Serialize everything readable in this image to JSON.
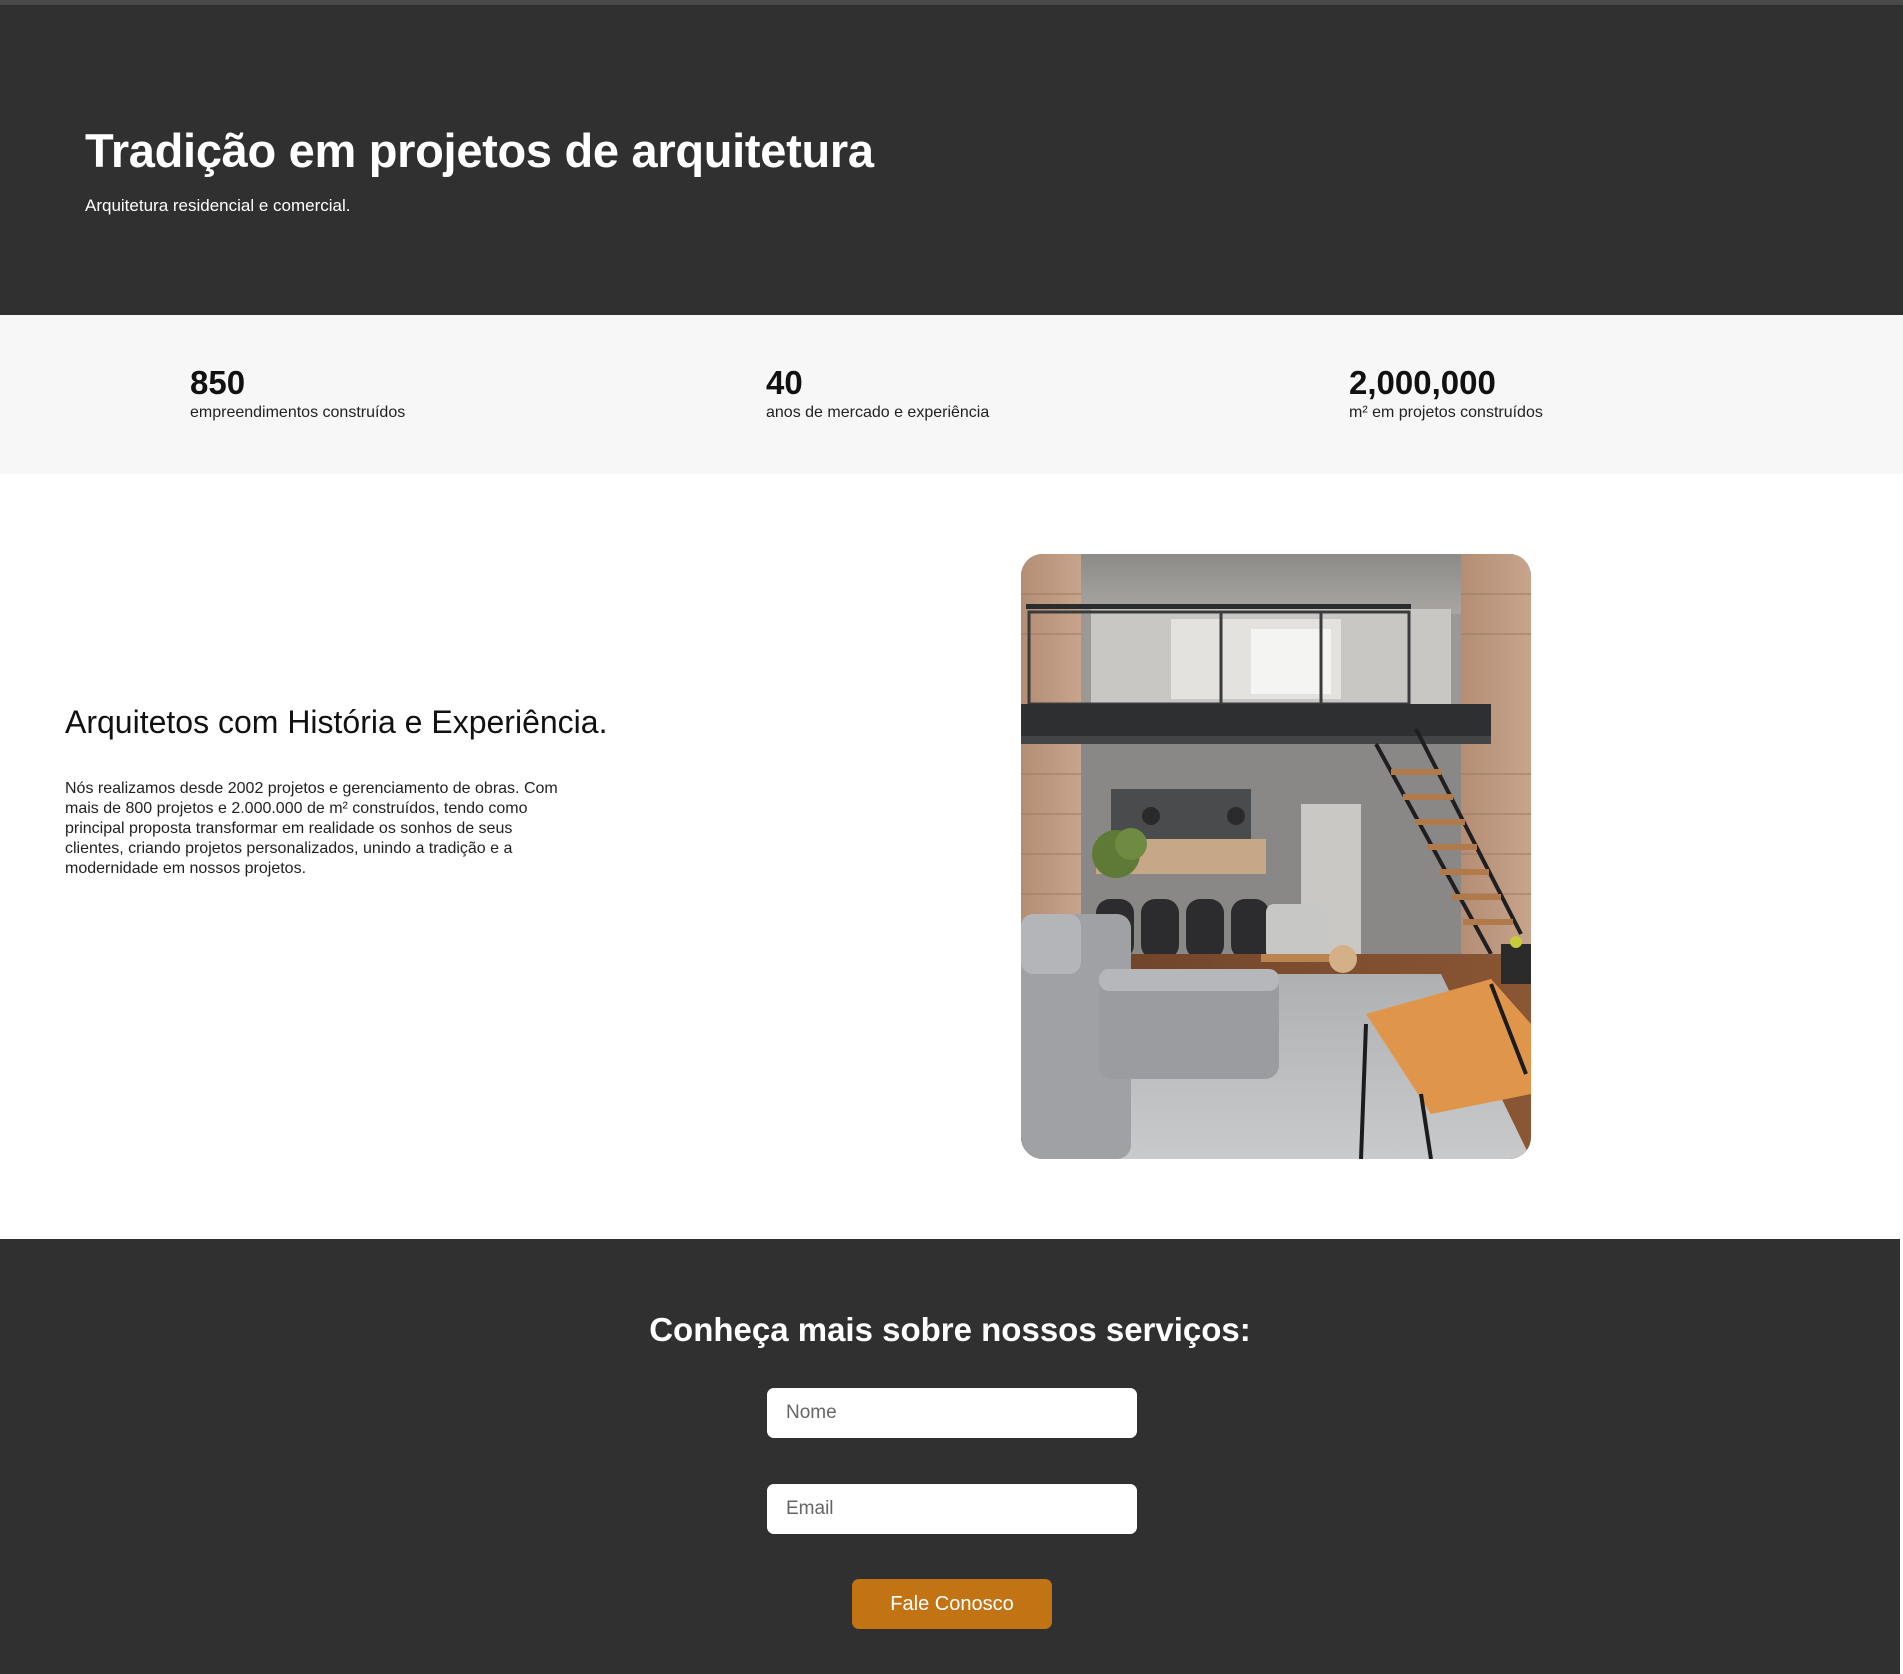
{
  "hero": {
    "title": "Tradição em projetos de arquitetura",
    "subtitle": "Arquitetura residencial e comercial."
  },
  "stats": [
    {
      "value": "850",
      "label": "empreendimentos construídos"
    },
    {
      "value": "40",
      "label": "anos de mercado e experiência"
    },
    {
      "value": "2,000,000",
      "label": "m² em projetos construídos"
    }
  ],
  "about": {
    "heading": "Arquitetos com História e Experiência.",
    "body": "Nós realizamos desde 2002 projetos e gerenciamento de obras. Com mais de 800 projetos e 2.000.000 de m² construídos, tendo como principal proposta transformar em realidade os sonhos de seus clientes, criando projetos personalizados, unindo a tradição e a modernidade em nossos projetos.",
    "image_icon": "loft-interior-photo"
  },
  "contact": {
    "heading": "Conheça mais sobre nossos serviços:",
    "name_placeholder": "Nome",
    "email_placeholder": "Email",
    "button_label": "Fale Conosco"
  },
  "colors": {
    "dark_bg": "#303030",
    "stats_bg": "#f7f7f7",
    "accent": "#c27415"
  }
}
